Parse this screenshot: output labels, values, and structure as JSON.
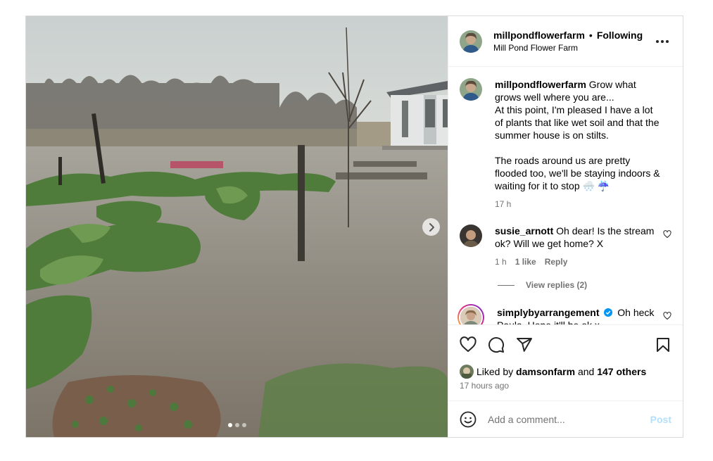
{
  "post": {
    "author": {
      "username": "millpondflowerfarm",
      "follow_separator": "•",
      "follow_status": "Following",
      "subtitle": "Mill Pond Flower Farm",
      "avatar_icon": "profile-avatar-icon"
    },
    "caption": {
      "username": "millpondflowerfarm",
      "lines": [
        "Grow what grows well where you are...",
        "At this point, I'm pleased I have a lot of plants that like wet soil and that the summer house is on stilts.",
        "The roads around us are pretty flooded too, we'll be staying indoors & waiting for it to stop 🌨️ ☔"
      ],
      "time": "17 h"
    },
    "comments": [
      {
        "username": "susie_arnott",
        "text": "Oh dear! Is the stream ok? Will we get home? X",
        "time": "1 h",
        "likes": "1 like",
        "reply": "Reply",
        "view_replies": "View replies (2)"
      },
      {
        "username": "simplybyarrangement",
        "verified": true,
        "text": "Oh heck Paula. Hope it'll be ok x"
      }
    ],
    "liked_by": {
      "prefix": "Liked by",
      "user": "damsonfarm",
      "middle": "and",
      "others": "147 others"
    },
    "timestamp": "17 hours ago",
    "add_comment": {
      "placeholder": "Add a comment...",
      "post_label": "Post"
    },
    "carousel": {
      "total": 3,
      "current": 1
    },
    "colors": {
      "link_disabled": "#b2dffc",
      "secondary_text": "#737373",
      "verified": "#0095f6",
      "border": "#dbdbdb"
    }
  }
}
